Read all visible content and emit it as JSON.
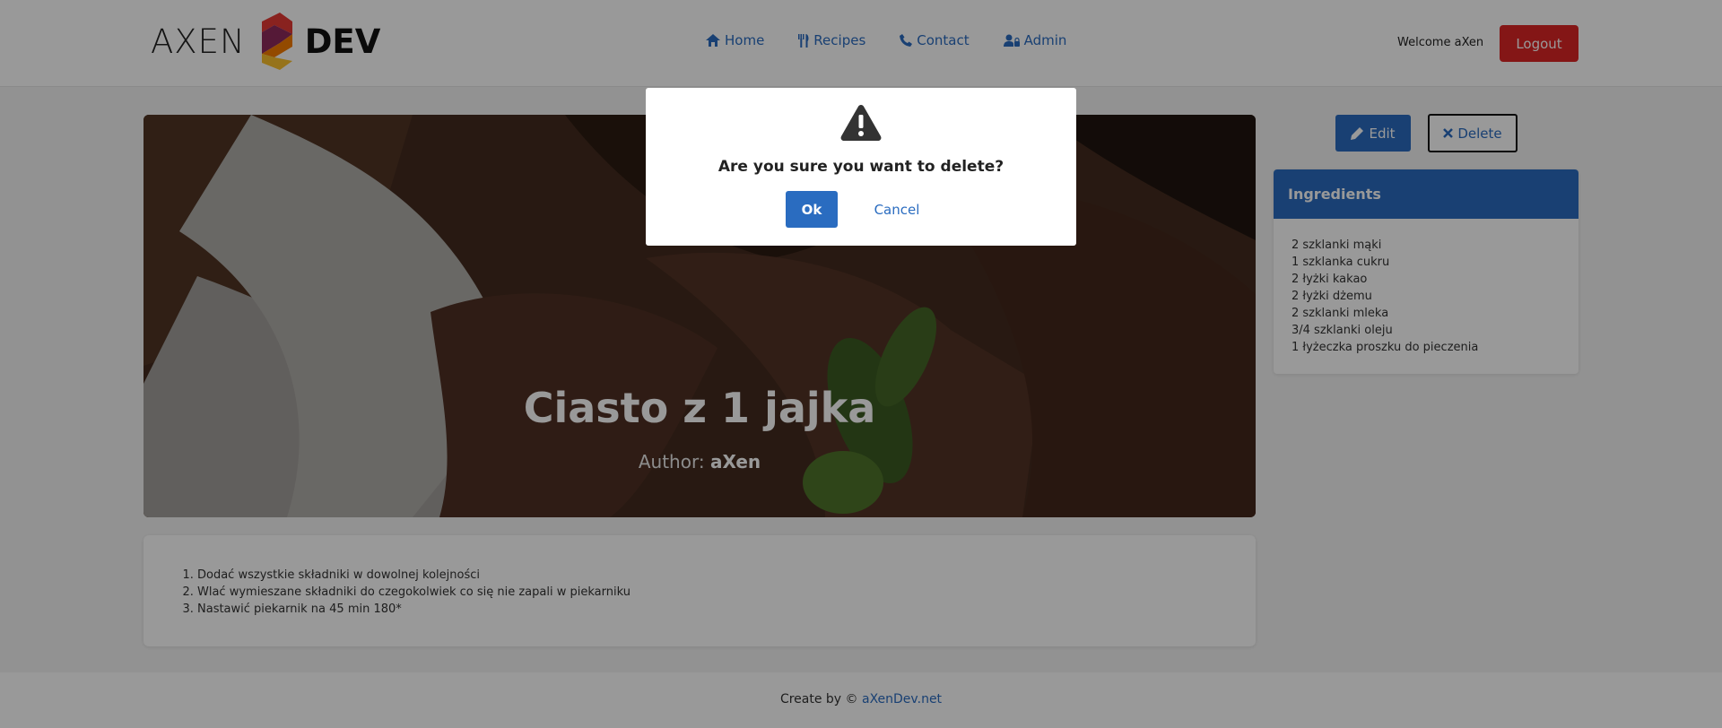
{
  "header": {
    "logo_left": "AXEN",
    "logo_right": "DEV",
    "nav": [
      {
        "label": "Home",
        "icon": "home-icon"
      },
      {
        "label": "Recipes",
        "icon": "utensils-icon"
      },
      {
        "label": "Contact",
        "icon": "phone-icon"
      },
      {
        "label": "Admin",
        "icon": "user-lock-icon"
      }
    ],
    "welcome": "Welcome aXen",
    "logout_label": "Logout"
  },
  "recipe": {
    "title": "Ciasto z 1 jajka",
    "author_label": "Author:",
    "author_name": "aXen",
    "steps": [
      "Dodać wszystkie składniki w dowolnej kolejności",
      "Wlać wymieszane składniki do czegokolwiek co się nie zapali w piekarniku",
      "Nastawić piekarnik na 45 min 180*"
    ]
  },
  "actions": {
    "edit_label": "Edit",
    "delete_label": "Delete"
  },
  "ingredients": {
    "title": "Ingredients",
    "items": [
      "2 szklanki mąki",
      "1 szklanka cukru",
      "2 łyżki kakao",
      "2 łyżki dżemu",
      "2 szklanki mleka",
      "3/4 szklanki oleju",
      "1 łyżeczka proszku do pieczenia"
    ]
  },
  "footer": {
    "prefix": "Create by ©",
    "link": "aXenDev.net"
  },
  "modal": {
    "message": "Are you sure you want to delete?",
    "ok_label": "Ok",
    "cancel_label": "Cancel"
  },
  "colors": {
    "accent": "#2a6cc0",
    "danger": "#dc2626"
  }
}
